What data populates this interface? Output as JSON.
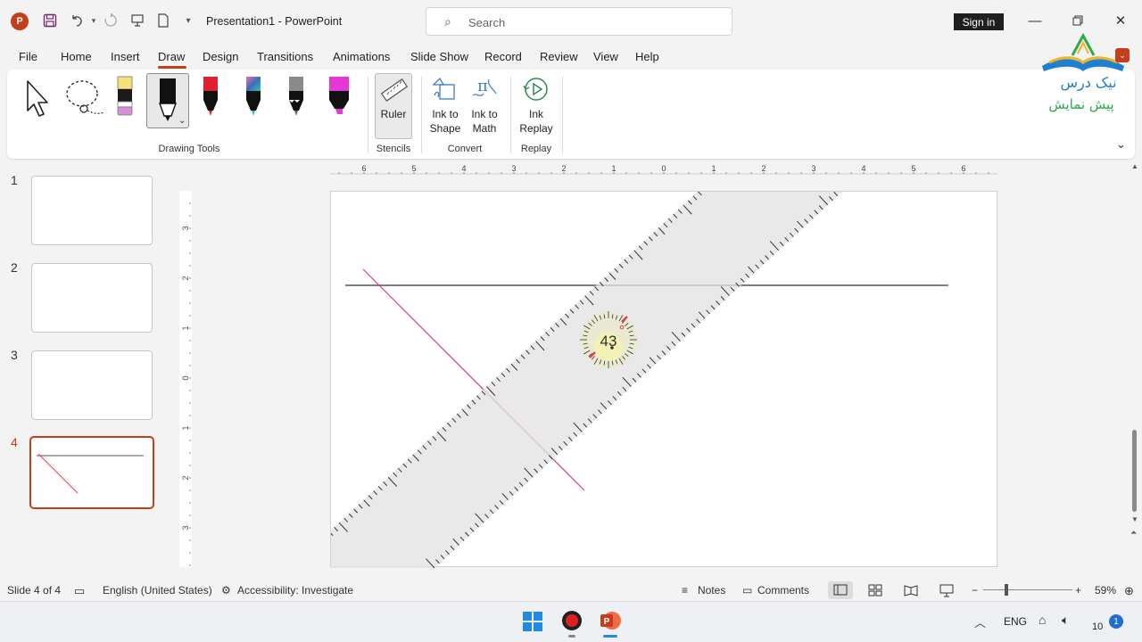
{
  "window": {
    "title": "Presentation1  -  PowerPoint",
    "search_placeholder": "Search",
    "signin_label": "Sign in"
  },
  "menu": {
    "items": [
      "File",
      "Home",
      "Insert",
      "Draw",
      "Design",
      "Transitions",
      "Animations",
      "Slide Show",
      "Record",
      "Review",
      "View",
      "Help"
    ],
    "active": "Draw"
  },
  "ribbon": {
    "groups": {
      "drawing_tools": "Drawing Tools",
      "stencils": "Stencils",
      "convert": "Convert",
      "replay": "Replay"
    },
    "ruler_label": "Ruler",
    "ink_to_shape": [
      "Ink to",
      "Shape"
    ],
    "ink_to_math": [
      "Ink to",
      "Math"
    ],
    "ink_replay": [
      "Ink",
      "Replay"
    ],
    "pen_colors": {
      "highlighter_yellow": "#f3e27a",
      "black_pen": "#111111",
      "red_pen": "#e0202e",
      "galaxy_pen": "#3d6fb6",
      "pencil": "#8a8a8a",
      "magenta_highlighter": "#e536d6"
    }
  },
  "slides": {
    "numbers": [
      "1",
      "2",
      "3",
      "4"
    ],
    "selected": "4"
  },
  "rulers": {
    "horizontal": [
      "6",
      "5",
      "4",
      "3",
      "2",
      "1",
      "0",
      "1",
      "2",
      "3",
      "4",
      "5",
      "6"
    ],
    "vertical": [
      "3",
      "2",
      "1",
      "0",
      "1",
      "2",
      "3"
    ]
  },
  "canvas": {
    "ruler_angle_label": "43"
  },
  "status": {
    "slide_info": "Slide 4 of 4",
    "language": "English (United States)",
    "accessibility": "Accessibility: Investigate",
    "notes": "Notes",
    "comments": "Comments",
    "zoom": "59%"
  },
  "taskbar": {
    "language": "ENG",
    "clock": "10",
    "notification_count": "1"
  },
  "watermark": {
    "line1": "نیک درس",
    "line2": "پیش نمایش"
  },
  "colors": {
    "accent": "#c43e1c",
    "ink_line": "#555555",
    "ink_red": "#e0405c"
  }
}
